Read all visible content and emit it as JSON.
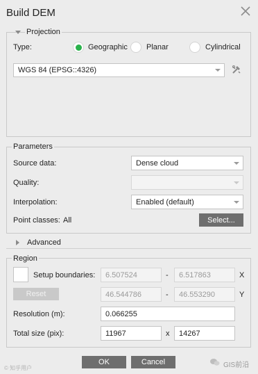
{
  "window": {
    "title": "Build DEM"
  },
  "projection": {
    "label": "Projection",
    "type_label": "Type:",
    "options": [
      {
        "label": "Geographic",
        "selected": true
      },
      {
        "label": "Planar",
        "selected": false
      },
      {
        "label": "Cylindrical",
        "selected": false
      }
    ],
    "crs_value": "WGS 84 (EPSG::4326)"
  },
  "parameters": {
    "label": "Parameters",
    "source_label": "Source data:",
    "source_value": "Dense cloud",
    "quality_label": "Quality:",
    "quality_value": "",
    "interp_label": "Interpolation:",
    "interp_value": "Enabled (default)",
    "point_classes_label": "Point classes:",
    "point_classes_value": "All",
    "select_button": "Select..."
  },
  "advanced": {
    "label": "Advanced"
  },
  "region": {
    "label": "Region",
    "setup_label": "Setup boundaries:",
    "x_min": "6.507524",
    "x_max": "6.517863",
    "y_min": "46.544786",
    "y_max": "46.553290",
    "dash": "-",
    "x_axis": "X",
    "y_axis": "Y",
    "reset_button": "Reset",
    "resolution_label": "Resolution (m):",
    "resolution_value": "0.066255",
    "total_size_label": "Total size (pix):",
    "width_value": "11967",
    "times": "x",
    "height_value": "14267"
  },
  "footer": {
    "ok_button": "OK",
    "cancel_button": "Cancel",
    "watermark_left": "© 知乎用户",
    "watermark_right": "GIS前沿"
  },
  "colors": {
    "accent_green": "#2bb24c",
    "button_dark": "#6e6e6e"
  }
}
